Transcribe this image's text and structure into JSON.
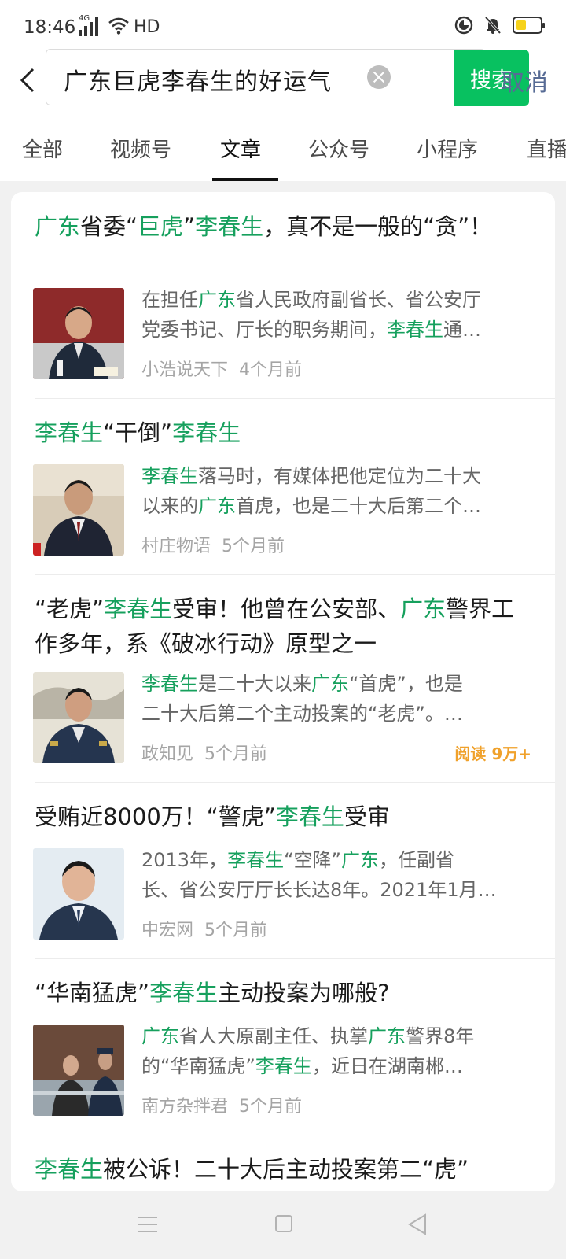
{
  "status_bar": {
    "time": "18:46",
    "network": "4G",
    "hd": "HD",
    "battery_level": 0.3
  },
  "search": {
    "query": "广东巨虎李春生的好运气",
    "button_label": "搜索",
    "cancel_label": "取消"
  },
  "tabs": [
    {
      "label": "全部"
    },
    {
      "label": "视频号"
    },
    {
      "label": "文章"
    },
    {
      "label": "公众号"
    },
    {
      "label": "小程序"
    },
    {
      "label": "直播"
    }
  ],
  "active_tab": "文章",
  "colors": {
    "accent_green": "#08c160",
    "highlight_green": "#16a05d",
    "link_blue": "#576b95",
    "read_orange": "#f0a12b"
  },
  "results": [
    {
      "title_parts": [
        {
          "t": "广东",
          "hl": true
        },
        {
          "t": "省委“",
          "hl": false
        },
        {
          "t": "巨虎",
          "hl": true
        },
        {
          "t": "”",
          "hl": false
        },
        {
          "t": "李春生",
          "hl": true
        },
        {
          "t": "，真不是一般的“贪”！",
          "hl": false
        }
      ],
      "snippet_line1": [
        {
          "t": "在担任",
          "hl": false
        },
        {
          "t": "广东",
          "hl": true
        },
        {
          "t": "省人民政府副省长、省公安厅",
          "hl": false
        }
      ],
      "snippet_line2": [
        {
          "t": "党委书记、厅长的职务期间，",
          "hl": false
        },
        {
          "t": "李春生",
          "hl": true
        },
        {
          "t": "通…",
          "hl": false
        }
      ],
      "source": "小浩说天下",
      "time": "4个月前",
      "read": ""
    },
    {
      "title_parts": [
        {
          "t": "李春生",
          "hl": true
        },
        {
          "t": "“干倒”",
          "hl": false
        },
        {
          "t": "李春生",
          "hl": true
        }
      ],
      "snippet_line1": [
        {
          "t": "李春生",
          "hl": true
        },
        {
          "t": "落马时，有媒体把他定位为二十大",
          "hl": false
        }
      ],
      "snippet_line2": [
        {
          "t": "以来的",
          "hl": false
        },
        {
          "t": "广东",
          "hl": true
        },
        {
          "t": "首虎，也是二十大后第二个…",
          "hl": false
        }
      ],
      "source": "村庄物语",
      "time": "5个月前",
      "read": ""
    },
    {
      "title_parts": [
        {
          "t": "“老虎”",
          "hl": false
        },
        {
          "t": "李春生",
          "hl": true
        },
        {
          "t": "受审！他曾在公安部、",
          "hl": false
        },
        {
          "t": "广东",
          "hl": true
        },
        {
          "t": "警界工作多年，系《破冰行动》原型之一",
          "hl": false
        }
      ],
      "snippet_line1": [
        {
          "t": "李春生",
          "hl": true
        },
        {
          "t": "是二十大以来",
          "hl": false
        },
        {
          "t": "广东",
          "hl": true
        },
        {
          "t": "“首虎”，也是",
          "hl": false
        }
      ],
      "snippet_line2": [
        {
          "t": "二十大后第二个主动投案的“老虎”。…",
          "hl": false
        }
      ],
      "source": "政知见",
      "time": "5个月前",
      "read": "阅读 9万+"
    },
    {
      "title_parts": [
        {
          "t": "受贿近8000万！“警虎”",
          "hl": false
        },
        {
          "t": "李春生",
          "hl": true
        },
        {
          "t": "受审",
          "hl": false
        }
      ],
      "snippet_line1": [
        {
          "t": "2013年，",
          "hl": false
        },
        {
          "t": "李春生",
          "hl": true
        },
        {
          "t": "“空降”",
          "hl": false
        },
        {
          "t": "广东",
          "hl": true
        },
        {
          "t": "，任副省",
          "hl": false
        }
      ],
      "snippet_line2": [
        {
          "t": "长、省公安厅厅长长达8年。2021年1月…",
          "hl": false
        }
      ],
      "source": "中宏网",
      "time": "5个月前",
      "read": ""
    },
    {
      "title_parts": [
        {
          "t": "“华南猛虎”",
          "hl": false
        },
        {
          "t": "李春生",
          "hl": true
        },
        {
          "t": "主动投案为哪般?",
          "hl": false
        }
      ],
      "snippet_line1": [
        {
          "t": "广东",
          "hl": true
        },
        {
          "t": "省人大原副主任、执掌",
          "hl": false
        },
        {
          "t": "广东",
          "hl": true
        },
        {
          "t": "警界8年",
          "hl": false
        }
      ],
      "snippet_line2": [
        {
          "t": "的“华南猛虎”",
          "hl": false
        },
        {
          "t": "李春生",
          "hl": true
        },
        {
          "t": "，近日在湖南郴…",
          "hl": false
        }
      ],
      "source": "南方杂拌君",
      "time": "5个月前",
      "read": ""
    },
    {
      "title_parts": [
        {
          "t": "李春生",
          "hl": true
        },
        {
          "t": "被公诉！二十大后主动投案第二“虎”",
          "hl": false
        }
      ],
      "snippet_line1": [],
      "snippet_line2": [],
      "source": "",
      "time": "",
      "read": ""
    }
  ]
}
